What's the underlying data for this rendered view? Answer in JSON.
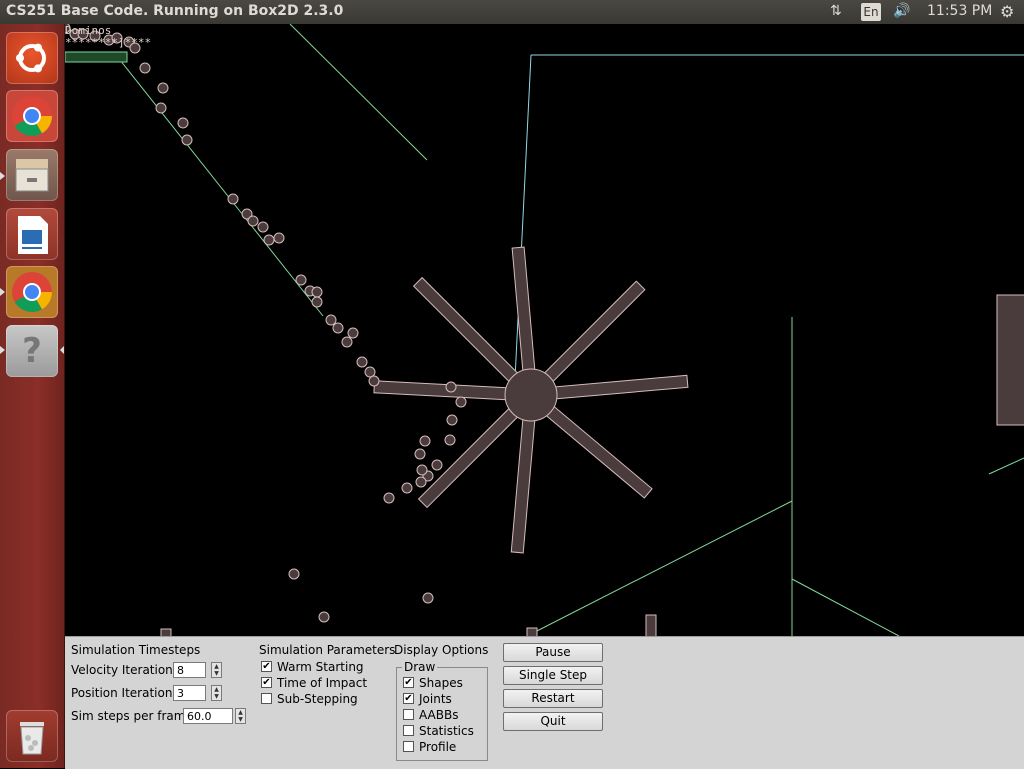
{
  "window": {
    "title": "CS251 Base Code. Running on Box2D 2.3.0"
  },
  "indicators": {
    "network_icon": "up-down-arrows",
    "keyboard_lang": "En",
    "volume_icon": "speaker",
    "clock": "11:53 PM",
    "settings_icon": "gear"
  },
  "launcher": {
    "items": [
      {
        "name": "ubuntu-dash",
        "icon": "ubuntu-logo"
      },
      {
        "name": "chrome",
        "icon": "chrome-logo"
      },
      {
        "name": "files",
        "icon": "file-cabinet"
      },
      {
        "name": "libreoffice-writer",
        "icon": "writer-doc"
      },
      {
        "name": "chrome-2",
        "icon": "chrome-logo"
      },
      {
        "name": "unknown-app",
        "icon": "question-mark",
        "glyph": "?"
      },
      {
        "name": "trash",
        "icon": "trash-can"
      }
    ]
  },
  "sim": {
    "overlay_line1": "Dominos",
    "overlay_line2": "********]****"
  },
  "panel": {
    "timesteps": {
      "heading": "Simulation Timesteps",
      "velocity_label": "Velocity Iterations",
      "velocity_value": "8",
      "position_label": "Position Iterations",
      "position_value": "3",
      "hz_label": "Sim steps per frame",
      "hz_value": "60.0"
    },
    "parameters": {
      "heading": "Simulation Parameters",
      "warm_starting": {
        "label": "Warm Starting",
        "checked": true
      },
      "time_of_impact": {
        "label": "Time of Impact",
        "checked": true
      },
      "sub_stepping": {
        "label": "Sub-Stepping",
        "checked": false
      }
    },
    "display": {
      "heading": "Display Options",
      "group_label": "Draw",
      "shapes": {
        "label": "Shapes",
        "checked": true
      },
      "joints": {
        "label": "Joints",
        "checked": true
      },
      "aabbs": {
        "label": "AABBs",
        "checked": false
      },
      "statistics": {
        "label": "Statistics",
        "checked": false
      },
      "profile": {
        "label": "Profile",
        "checked": false
      }
    },
    "buttons": {
      "pause": "Pause",
      "single_step": "Single Step",
      "restart": "Restart",
      "quit": "Quit"
    }
  },
  "colors": {
    "body_fill": "#4a3c3c",
    "body_outline": "#d6bcbc",
    "static_line": "#7fd99a",
    "static_line_2": "#8fd9e6"
  }
}
